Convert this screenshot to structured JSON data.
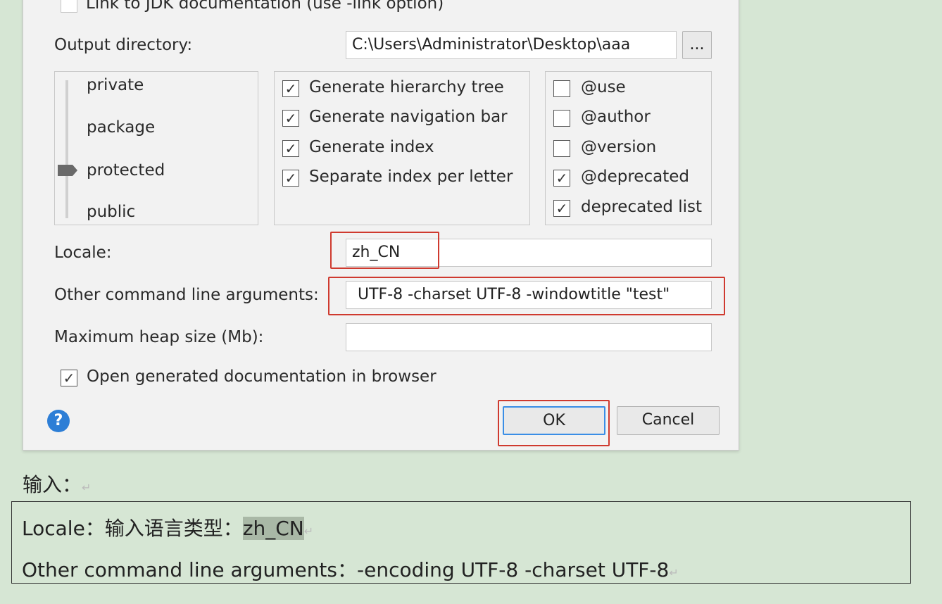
{
  "dialog": {
    "link_jdk_label": "Link to JDK documentation (use -link option)",
    "output_dir_label": "Output directory:",
    "output_dir_value": "C:\\Users\\Administrator\\Desktop\\aaa",
    "browse_label": "...",
    "scope_levels": [
      "private",
      "package",
      "protected",
      "public"
    ],
    "selected_scope": "protected",
    "generate_options": [
      {
        "label": "Generate hierarchy tree",
        "checked": true
      },
      {
        "label": "Generate navigation bar",
        "checked": true
      },
      {
        "label": "Generate index",
        "checked": true
      },
      {
        "label": "Separate index per letter",
        "checked": true
      }
    ],
    "tag_options": [
      {
        "label": "@use",
        "checked": false
      },
      {
        "label": "@author",
        "checked": false
      },
      {
        "label": "@version",
        "checked": false
      },
      {
        "label": "@deprecated",
        "checked": true
      },
      {
        "label": "deprecated list",
        "checked": true
      }
    ],
    "locale_label": "Locale:",
    "locale_value": "zh_CN",
    "args_label": "Other command line arguments:",
    "args_value": "UTF-8 -charset UTF-8 -windowtitle \"test\"",
    "heap_label": "Maximum heap size (Mb):",
    "heap_value": "",
    "open_browser_label": "Open generated documentation in browser",
    "open_browser_checked": true,
    "help_label": "?",
    "ok_label": "OK",
    "cancel_label": "Cancel"
  },
  "document": {
    "heading": "输入：",
    "line1_prefix": "Locale：输入语言类型：",
    "line1_value": "zh_CN",
    "line2": "Other command line arguments：-encoding UTF-8 -charset UTF-8",
    "para_mark": "↵"
  },
  "colors": {
    "highlight_border": "#cf3a2f",
    "help_icon": "#2d7ed6",
    "ok_border": "#3a8ee6",
    "background": "#d6e6d4"
  }
}
